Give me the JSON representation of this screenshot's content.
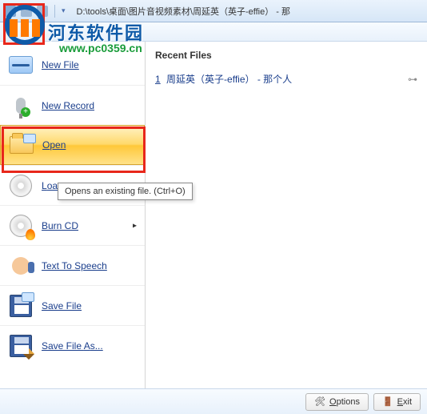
{
  "titlebar": {
    "path": "D:\\tools\\桌面\\图片音视频素材\\周延英（英子-effie） - 那"
  },
  "menu": {
    "items": [
      {
        "label": "New File",
        "name": "menu-new-file"
      },
      {
        "label": "New Record",
        "name": "menu-new-record"
      },
      {
        "label": "Open",
        "name": "menu-open",
        "highlight": true
      },
      {
        "label": "Load CD",
        "name": "menu-load-cd",
        "has_submenu": true
      },
      {
        "label": "Burn CD",
        "name": "menu-burn-cd",
        "has_submenu": true
      },
      {
        "label": "Text To Speech",
        "name": "menu-text-to-speech"
      },
      {
        "label": "Save File",
        "name": "menu-save-file"
      },
      {
        "label": "Save File As...",
        "name": "menu-save-file-as"
      }
    ]
  },
  "tooltip": {
    "text": "Opens an existing file. (Ctrl+O)"
  },
  "recent": {
    "heading": "Recent Files",
    "items": [
      {
        "index": "1",
        "label": "周延英（英子-effie） - 那个人"
      }
    ]
  },
  "footer": {
    "options": "Options",
    "exit": "Exit"
  },
  "watermark": {
    "line1": "河东软件园",
    "line2": "www.pc0359.cn"
  }
}
